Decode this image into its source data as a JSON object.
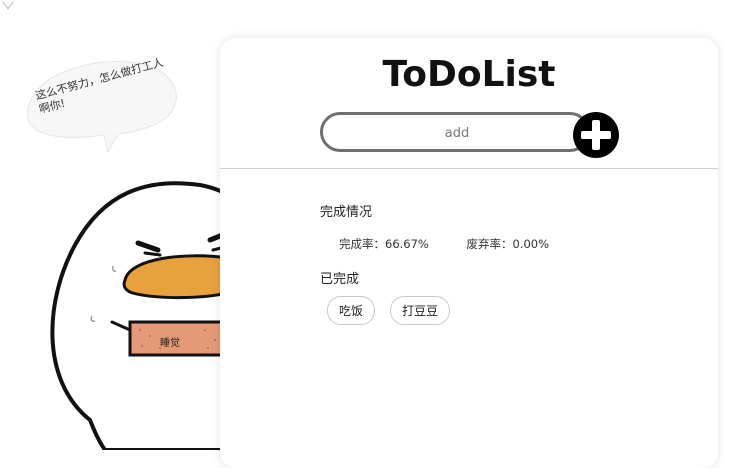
{
  "app": {
    "title": "ToDoList"
  },
  "input": {
    "placeholder": "add"
  },
  "add_button": {
    "icon": "plus-icon"
  },
  "status": {
    "section_title": "完成情况",
    "completion_rate_label": "完成率：",
    "completion_rate_value": "66.67%",
    "abandon_rate_label": "废弃率：",
    "abandon_rate_value": "0.00%"
  },
  "completed": {
    "section_title": "已完成",
    "items": [
      "吃饭",
      "打豆豆"
    ]
  },
  "mascot": {
    "speech": "这么不努力，怎么做打工人啊你!",
    "mouth_tape_label": "睡觉"
  },
  "colors": {
    "accent_dark": "#000000",
    "beak": "#e9a13d",
    "tape": "#e49a77"
  }
}
